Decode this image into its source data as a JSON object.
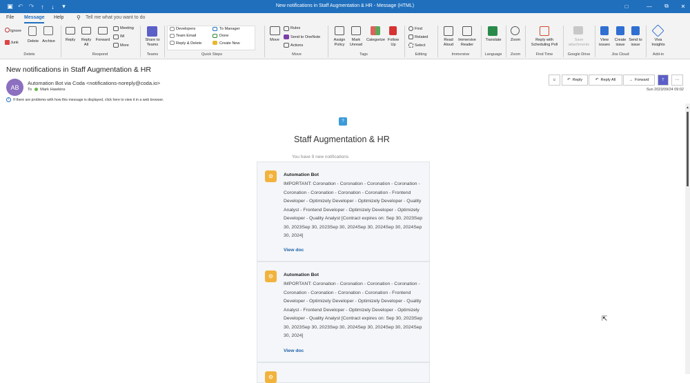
{
  "window": {
    "title": "New notifications in Staff Augmentation & HR  -  Message (HTML)"
  },
  "menu": {
    "tabs": [
      "File",
      "Message",
      "Help"
    ],
    "tell_me": "Tell me what you want to do"
  },
  "ribbon": {
    "delete": {
      "ignore": "Ignore",
      "junk": "Junk",
      "delete": "Delete",
      "archive": "Archive",
      "group": "Delete"
    },
    "respond": {
      "reply": "Reply",
      "reply_all": "Reply All",
      "forward": "Forward",
      "meeting": "Meeting",
      "im": "IM",
      "more": "More",
      "group": "Respond"
    },
    "teams": {
      "share": "Share to Teams",
      "group": "Teams"
    },
    "quick_steps": {
      "items": [
        "Developers",
        "Team Email",
        "Reply & Delete",
        "To Manager",
        "Done",
        "Create New"
      ],
      "group": "Quick Steps"
    },
    "move": {
      "move": "Move",
      "rules": "Rules",
      "onenote": "Send to OneNote",
      "actions": "Actions",
      "group": "Move"
    },
    "tags": {
      "assign": "Assign Policy",
      "unread": "Mark Unread",
      "categorize": "Categorize",
      "follow": "Follow Up",
      "group": "Tags"
    },
    "editing": {
      "find": "Find",
      "related": "Related",
      "select": "Select",
      "group": "Editing"
    },
    "immersive": {
      "read_aloud": "Read Aloud",
      "reader": "Immersive Reader",
      "group": "Immersive"
    },
    "language": {
      "translate": "Translate",
      "group": "Language"
    },
    "zoom": {
      "zoom": "Zoom",
      "group": "Zoom"
    },
    "findtime": {
      "reply_poll": "Reply with Scheduling Poll",
      "group": "Find Time"
    },
    "gdrive": {
      "save": "Save attachments",
      "group": "Google Drive"
    },
    "jira": {
      "view": "View issues",
      "create": "Create issue",
      "send": "Send to issue",
      "group": "Jira Cloud"
    },
    "addin": {
      "viva": "Viva Insights",
      "group": "Add-in"
    }
  },
  "message": {
    "subject": "New notifications in Staff Augmentation & HR",
    "avatar_initials": "AB",
    "sender": "Automation Bot via Coda <notifications-noreply@coda.io>",
    "to_label": "To",
    "to_name": "Mark Hawkins",
    "info": "If there are problems with how this message is displayed, click here to view it in a web browser.",
    "date": "Sun 2023/09/24 09:02",
    "actions": {
      "reply": "Reply",
      "reply_all": "Reply All",
      "forward": "Forward"
    }
  },
  "body": {
    "logo_char": "?",
    "doc_title": "Staff Augmentation & HR",
    "new_count": "You have 9 new notifications",
    "cards": [
      {
        "name": "Automation Bot",
        "message": "IMPORTANT: Coronation - Coronation - Coronation - Coronation - Coronation - Coronation - Coronation - Coronation - Frontend Developer - Optimizely Developer - Optimizely Developer - Quality Analyst - Frontend Developer - Optimizely Developer - Optimizely Developer - Quality Analyst [Contract expires on: Sep 30, 2023Sep 30, 2023Sep 30, 2023Sep 30, 2024Sep 30, 2024Sep 30, 2024Sep 30, 2024]",
        "link": "View doc"
      },
      {
        "name": "Automation Bot",
        "message": "IMPORTANT: Coronation - Coronation - Coronation - Coronation - Coronation - Coronation - Coronation - Coronation - Frontend Developer - Optimizely Developer - Optimizely Developer - Quality Analyst - Frontend Developer - Optimizely Developer - Optimizely Developer - Quality Analyst [Contract expires on: Sep 30, 2023Sep 30, 2023Sep 30, 2023Sep 30, 2024Sep 30, 2024Sep 30, 2024Sep 30, 2024]",
        "link": "View doc"
      }
    ]
  },
  "colors": {
    "accent": "#1f6fbd",
    "avatar": "#8c6fbf",
    "bot": "#f2b33d",
    "link": "#1b5fa8"
  }
}
